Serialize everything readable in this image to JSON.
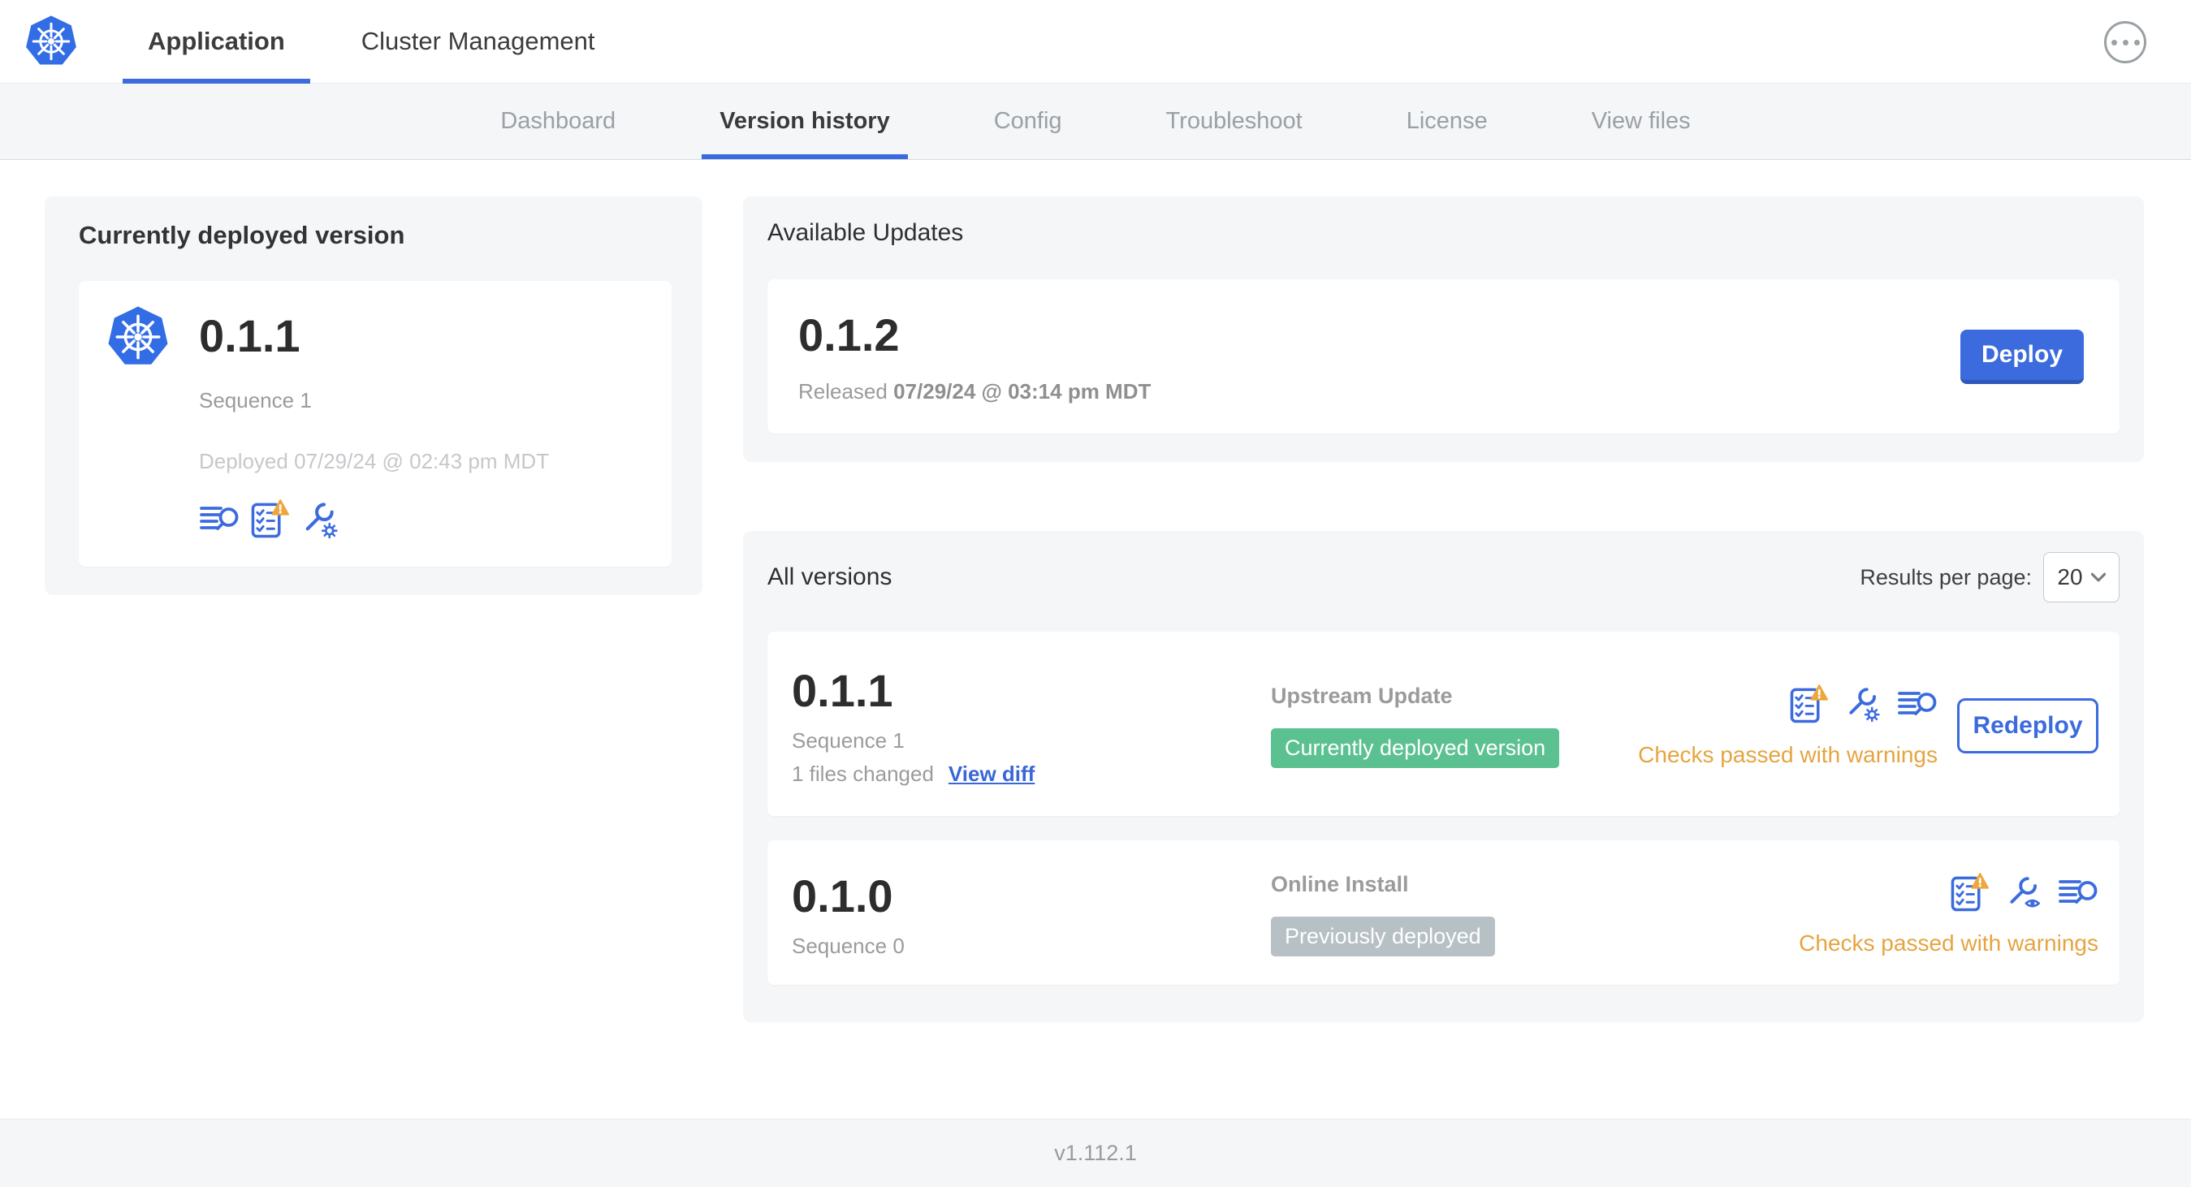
{
  "header": {
    "tabs": [
      {
        "label": "Application"
      },
      {
        "label": "Cluster Management"
      }
    ]
  },
  "subnav": {
    "items": [
      {
        "label": "Dashboard"
      },
      {
        "label": "Version history"
      },
      {
        "label": "Config"
      },
      {
        "label": "Troubleshoot"
      },
      {
        "label": "License"
      },
      {
        "label": "View files"
      }
    ]
  },
  "current_version": {
    "title": "Currently deployed version",
    "version": "0.1.1",
    "sequence": "Sequence 1",
    "deployed": "Deployed 07/29/24 @ 02:43 pm MDT"
  },
  "available_updates": {
    "title": "Available Updates",
    "version": "0.1.2",
    "released_label": "Released",
    "released_date": "07/29/24 @ 03:14 pm MDT",
    "deploy_button": "Deploy"
  },
  "all_versions": {
    "title": "All versions",
    "results_per_page_label": "Results per page:",
    "results_per_page_value": "20",
    "rows": [
      {
        "version": "0.1.1",
        "sequence": "Sequence 1",
        "files_changed": "1 files changed",
        "view_diff_link": "View diff",
        "source": "Upstream Update",
        "badge": "Currently deployed version",
        "status": "Checks passed with warnings",
        "action_button": "Redeploy"
      },
      {
        "version": "0.1.0",
        "sequence": "Sequence 0",
        "source": "Online Install",
        "badge": "Previously deployed",
        "status": "Checks passed with warnings"
      }
    ]
  },
  "footer": {
    "app_version": "v1.112.1"
  },
  "icons": {
    "header_logo": "kubernetes-logo",
    "header_menu": "ellipsis-circle",
    "current_version_actions": [
      "deploy-logs",
      "preflight-checks-warning",
      "config-edit"
    ],
    "row_0_actions": [
      "preflight-checks-warning",
      "config-edit",
      "deploy-logs"
    ],
    "row_1_actions": [
      "preflight-checks-warning",
      "config-view",
      "deploy-logs"
    ],
    "results_select": "chevron-down"
  },
  "colors": {
    "primary_blue": "#3b6bdd",
    "kubernetes_blue": "#326de6",
    "success_green": "#5cc191",
    "previous_gray": "#b7c0c5",
    "warning_orange": "#e6a440",
    "link_blue": "#3a66d8"
  }
}
